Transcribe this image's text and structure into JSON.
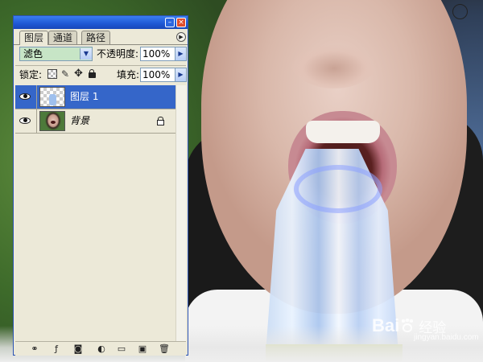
{
  "layers_panel": {
    "tabs": [
      {
        "label": "图层",
        "active": true
      },
      {
        "label": "通道",
        "active": false
      },
      {
        "label": "路径",
        "active": false
      }
    ],
    "blend_mode": "滤色",
    "opacity_label": "不透明度:",
    "opacity_value": "100%",
    "lock_label": "锁定:",
    "fill_label": "填充:",
    "fill_value": "100%",
    "layers": [
      {
        "name": "图层 1",
        "selected": true,
        "visible": true,
        "thumbnail": "transparent-layer",
        "locked": false
      },
      {
        "name": "背景",
        "selected": false,
        "visible": true,
        "thumbnail": "photo-face",
        "locked": true
      }
    ],
    "bottom_tools": [
      "link-icon",
      "layer-style-icon",
      "layer-mask-icon",
      "adjustment-layer-icon",
      "new-group-icon",
      "new-layer-icon",
      "trash-icon"
    ]
  },
  "watermark": {
    "brand_left": "Bai",
    "brand_right": "经验",
    "url": "jingyan.baidu.com"
  },
  "colors": {
    "panel_bg": "#ece9d8",
    "title_blue": "#1e58d4",
    "selected_layer": "#3566c9",
    "blend_field_bg": "#c7e5c6"
  }
}
